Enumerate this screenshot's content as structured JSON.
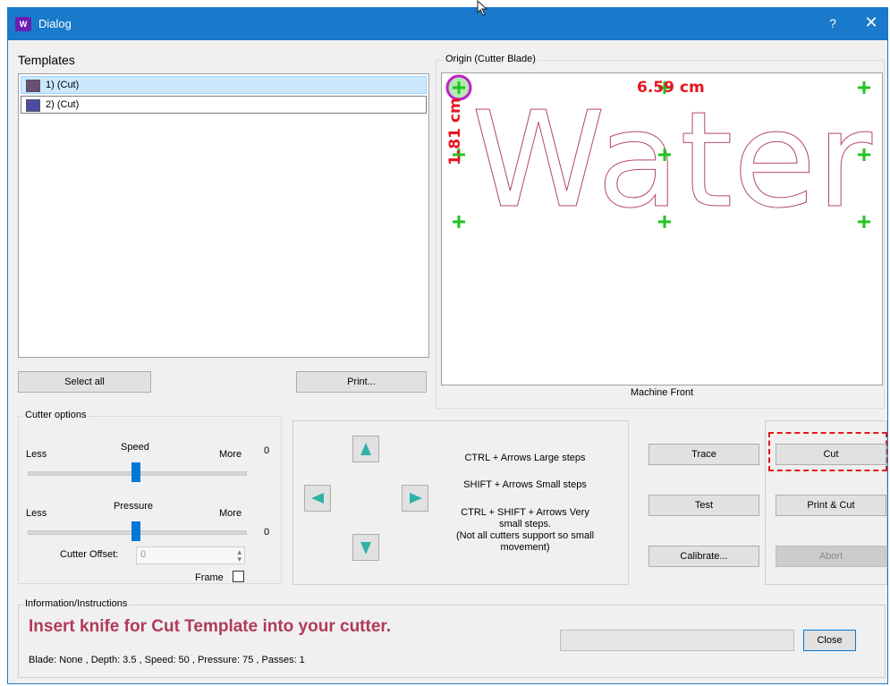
{
  "window": {
    "title": "Dialog",
    "help_label": "?",
    "close_label": "✕"
  },
  "templates": {
    "label": "Templates",
    "items": [
      {
        "label": "1) (Cut)",
        "color": "#6d4d79"
      },
      {
        "label": "2) (Cut)",
        "color": "#4c4ca8"
      }
    ],
    "select_all": "Select all",
    "print": "Print..."
  },
  "origin": {
    "label": "Origin (Cutter Blade)",
    "preview_text": "Water",
    "width_label": "6.59 cm",
    "height_label": "1.81 cm",
    "machine_front": "Machine Front"
  },
  "cutter_options": {
    "label": "Cutter options",
    "speed": {
      "label": "Speed",
      "less": "Less",
      "more": "More",
      "value": "0"
    },
    "pressure": {
      "label": "Pressure",
      "less": "Less",
      "more": "More",
      "value": "0"
    },
    "offset_label": "Cutter Offset:",
    "offset_value": "0",
    "frame_label": "Frame"
  },
  "movement": {
    "line1": "CTRL + Arrows  Large steps",
    "line2": "SHIFT + Arrows  Small steps",
    "line3": "CTRL + SHIFT + Arrows  Very",
    "line4": "small steps.",
    "line5": "(Not all cutters support so small",
    "line6": "movement)"
  },
  "actions": {
    "trace": "Trace",
    "test": "Test",
    "calibrate": "Calibrate...",
    "cut": "Cut",
    "print_cut": "Print & Cut",
    "abort": "Abort"
  },
  "info": {
    "label": "Information/Instructions",
    "message": "Insert knife for Cut Template into your cutter.",
    "details": "Blade: None ,  Depth:  3.5 , Speed: 50 , Pressure: 75 , Passes: 1",
    "close": "Close"
  },
  "colors": {
    "accent": "#1979ca",
    "message": "#b03a5b",
    "measure": "#e8141e",
    "marker": "#22c422"
  }
}
